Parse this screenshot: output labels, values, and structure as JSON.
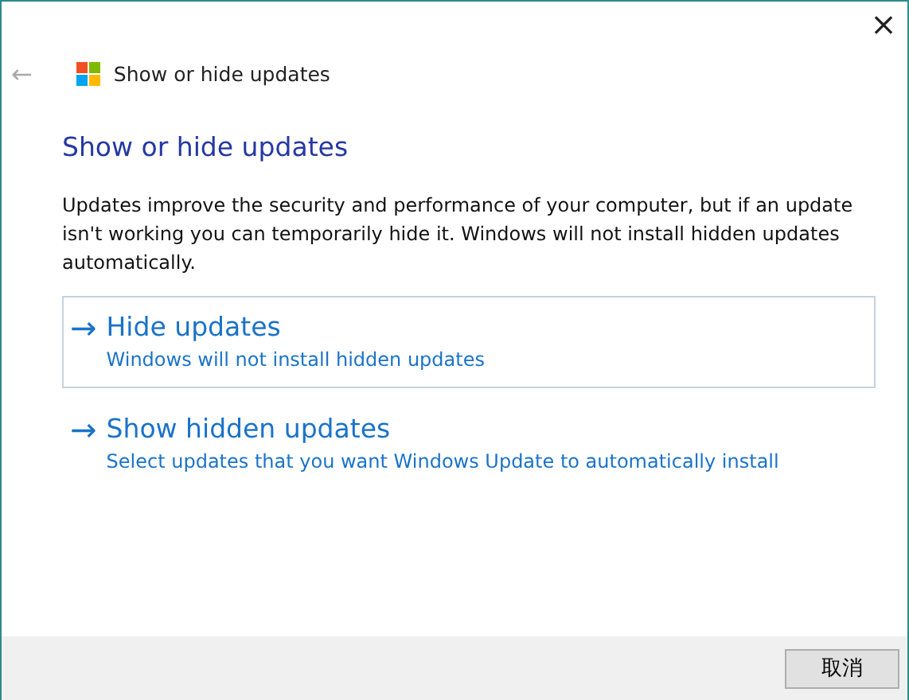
{
  "window": {
    "close": "×",
    "back": "←",
    "title": "Show or hide updates"
  },
  "heading": "Show or hide updates",
  "description": "Updates improve the security and performance of your computer, but if an update isn't working you can temporarily hide it. Windows will not install hidden updates automatically.",
  "options": [
    {
      "arrow": "→",
      "title": "Hide updates",
      "subtitle": "Windows will not install hidden updates",
      "selected": true
    },
    {
      "arrow": "→",
      "title": "Show hidden updates",
      "subtitle": "Select updates that you want Windows Update to automatically install",
      "selected": false
    }
  ],
  "buttons": [
    {
      "label": "取消"
    }
  ]
}
